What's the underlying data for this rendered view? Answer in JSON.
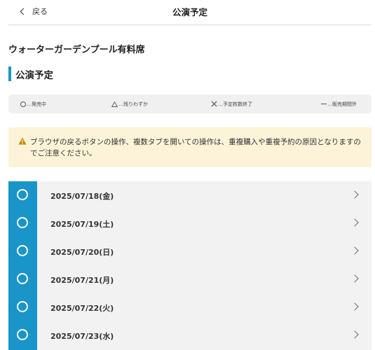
{
  "header": {
    "back_label": "戻る",
    "title": "公演予定"
  },
  "venue_title": "ウォーターガーデンプール有料席",
  "section_title": "公演予定",
  "legend": {
    "available": "…発売中",
    "few_left": "…残りわずか",
    "sold_out": "…予定枚数終了",
    "not_on_sale": "…販売期間外"
  },
  "warning": {
    "icon": "warning-triangle-icon",
    "message": "ブラウザの戻るボタンの操作、複数タブを開いての操作は、重複購入や重複予約の原因となりますのでご注意ください。"
  },
  "colors": {
    "accent": "#1a95c9",
    "warning_bg": "#fdf3d9",
    "warning_icon": "#c48a00",
    "list_bg": "#f2f2f2"
  },
  "dates": [
    {
      "status": "available",
      "date": "2025/07/18(金)"
    },
    {
      "status": "available",
      "date": "2025/07/19(土)"
    },
    {
      "status": "available",
      "date": "2025/07/20(日)"
    },
    {
      "status": "available",
      "date": "2025/07/21(月)"
    },
    {
      "status": "available",
      "date": "2025/07/22(火)"
    },
    {
      "status": "available",
      "date": "2025/07/23(水)"
    }
  ]
}
